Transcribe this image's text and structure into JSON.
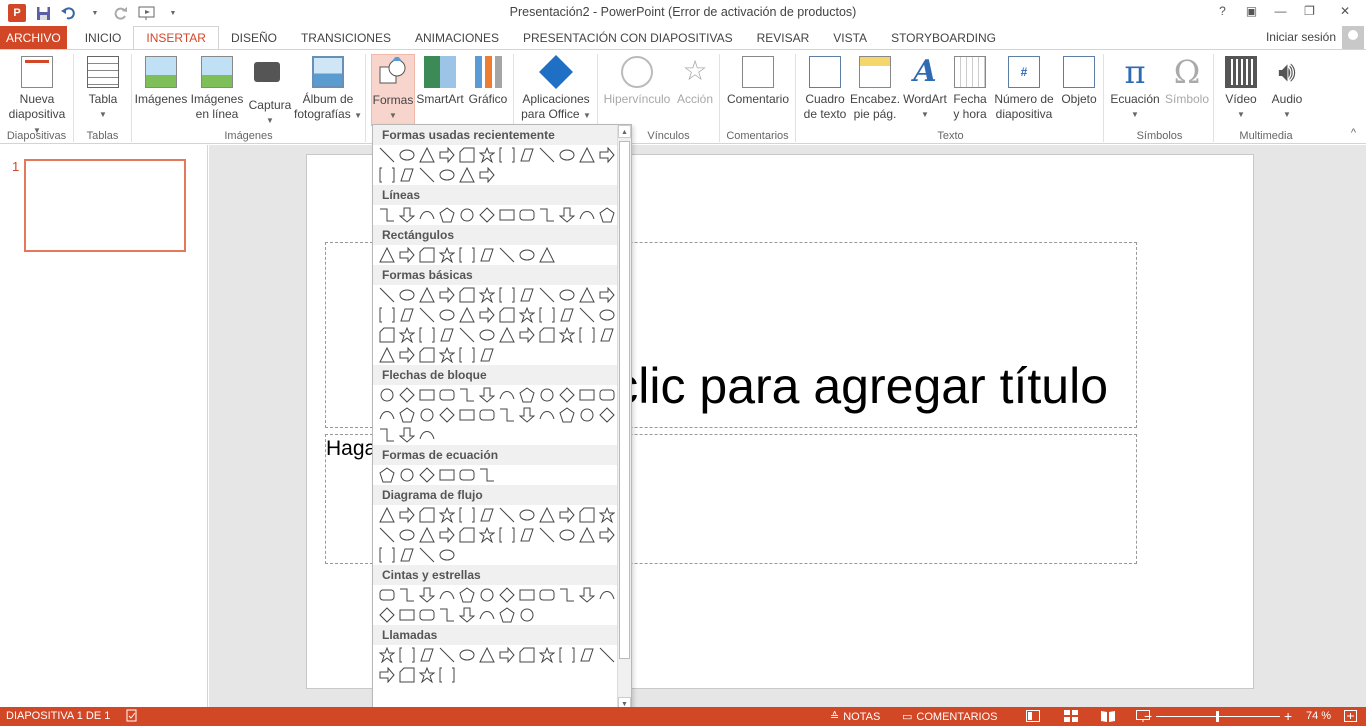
{
  "window": {
    "title": "Presentación2 - PowerPoint (Error de activación de productos)",
    "app_logo": "P"
  },
  "qat": [
    "save-icon",
    "undo-icon",
    "redo-icon",
    "start-from-beginning-icon"
  ],
  "window_controls": {
    "help": "?",
    "ribbon_options": "▣",
    "minimize": "—",
    "restore": "❐",
    "close": "✕"
  },
  "tabs": {
    "file": "ARCHIVO",
    "items": [
      "INICIO",
      "INSERTAR",
      "DISEÑO",
      "TRANSICIONES",
      "ANIMACIONES",
      "PRESENTACIÓN CON DIAPOSITIVAS",
      "REVISAR",
      "VISTA",
      "STORYBOARDING"
    ],
    "active": "INSERTAR",
    "signin": "Iniciar sesión"
  },
  "ribbon": {
    "groups": {
      "diapositivas": "Diapositivas",
      "tablas": "Tablas",
      "imagenes": "Imágenes",
      "vinculos": "Vínculos",
      "comentarios": "Comentarios",
      "texto": "Texto",
      "simbolos": "Símbolos",
      "multimedia": "Multimedia"
    },
    "buttons": {
      "nueva1": "Nueva",
      "nueva2": "diapositiva",
      "tabla": "Tabla",
      "imagenes": "Imágenes",
      "enlinea1": "Imágenes",
      "enlinea2": "en línea",
      "captura": "Captura",
      "album1": "Álbum de",
      "album2": "fotografías",
      "formas": "Formas",
      "smartart": "SmartArt",
      "grafico": "Gráfico",
      "apps1": "Aplicaciones",
      "apps2": "para Office",
      "hipervinculo": "Hipervínculo",
      "accion": "Acción",
      "comentario": "Comentario",
      "cuadro1": "Cuadro",
      "cuadro2": "de texto",
      "encab1": "Encabez.",
      "encab2": "pie pág.",
      "wordart": "WordArt",
      "fecha1": "Fecha",
      "fecha2": "y hora",
      "num1": "Número de",
      "num2": "diapositiva",
      "objeto": "Objeto",
      "ecuacion": "Ecuación",
      "simbolo": "Símbolo",
      "video": "Vídeo",
      "audio": "Audio"
    },
    "collapse": "^"
  },
  "thumbnails": {
    "slide_number": "1"
  },
  "slide": {
    "title_placeholder": "Haga clic para agregar título",
    "subtitle_placeholder": "Haga clic para agregar subtítulo"
  },
  "shapes_menu": {
    "categories": [
      {
        "label": "Formas usadas recientemente",
        "rows": [
          12,
          6
        ]
      },
      {
        "label": "Líneas",
        "rows": [
          12
        ]
      },
      {
        "label": "Rectángulos",
        "rows": [
          9
        ]
      },
      {
        "label": "Formas básicas",
        "rows": [
          12,
          12,
          12,
          6
        ]
      },
      {
        "label": "Flechas de bloque",
        "rows": [
          12,
          12,
          3
        ]
      },
      {
        "label": "Formas de ecuación",
        "rows": [
          6
        ]
      },
      {
        "label": "Diagrama de flujo",
        "rows": [
          12,
          12,
          4
        ]
      },
      {
        "label": "Cintas y estrellas",
        "rows": [
          12,
          8
        ]
      },
      {
        "label": "Llamadas",
        "rows": [
          12,
          4
        ]
      }
    ]
  },
  "statusbar": {
    "slide_info": "DIAPOSITIVA 1 DE 1",
    "notas": "NOTAS",
    "comentarios": "COMENTARIOS",
    "zoom": "74 %",
    "zoom_minus": "−",
    "zoom_plus": "+"
  },
  "colors": {
    "accent": "#d24726",
    "ribbon_selected": "#f7d5cc"
  }
}
